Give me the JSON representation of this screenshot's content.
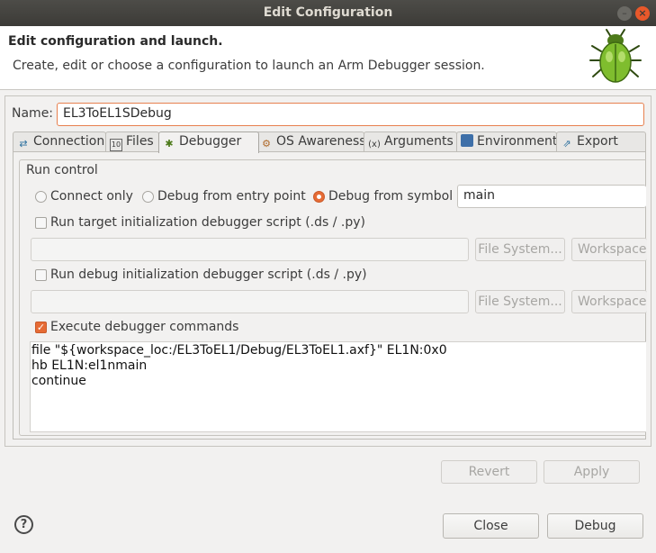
{
  "window": {
    "title": "Edit Configuration"
  },
  "header": {
    "title": "Edit configuration and launch.",
    "description": "Create, edit or choose a configuration to launch an Arm Debugger session."
  },
  "name": {
    "label": "Name:",
    "value": "EL3ToEL1SDebug"
  },
  "tabs": [
    {
      "label": "Connection",
      "icon": "connection-icon"
    },
    {
      "label": "Files",
      "icon": "files-icon"
    },
    {
      "label": "Debugger",
      "icon": "debugger-icon",
      "active": true
    },
    {
      "label": "OS Awareness",
      "icon": "gear-icon"
    },
    {
      "label": "Arguments",
      "icon": "arguments-icon"
    },
    {
      "label": "Environment",
      "icon": "environment-icon"
    },
    {
      "label": "Export",
      "icon": "export-icon"
    }
  ],
  "run_control": {
    "group_label": "Run control",
    "radios": [
      {
        "label": "Connect only",
        "selected": false
      },
      {
        "label": "Debug from entry point",
        "selected": false
      },
      {
        "label": "Debug from symbol",
        "selected": true
      }
    ],
    "symbol_value": "main",
    "target_init": {
      "label": "Run target initialization debugger script (.ds / .py)",
      "checked": false,
      "path": ""
    },
    "debug_init": {
      "label": "Run debug initialization debugger script (.ds / .py)",
      "checked": false,
      "path": ""
    },
    "file_system_label": "File System...",
    "workspace_label": "Workspace",
    "execute": {
      "label": "Execute debugger commands",
      "checked": true
    },
    "commands": "file \"${workspace_loc:/EL3ToEL1/Debug/EL3ToEL1.axf}\" EL1N:0x0\nhb EL1N:el1nmain\ncontinue"
  },
  "actions": {
    "revert": "Revert",
    "apply": "Apply"
  },
  "footer": {
    "help": "?",
    "close": "Close",
    "debug": "Debug"
  },
  "colors": {
    "accent": "#e66b35",
    "titlebar": "#3c3b37"
  }
}
